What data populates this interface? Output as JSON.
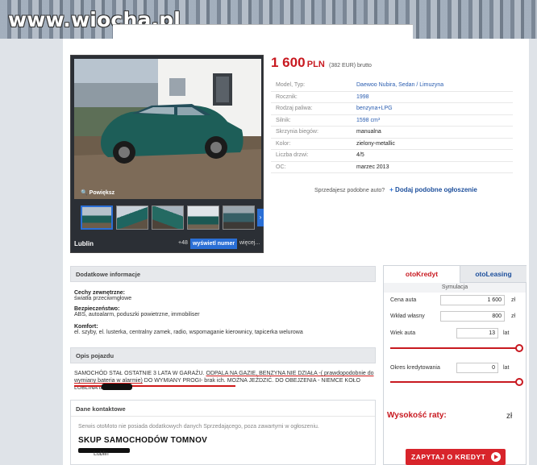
{
  "watermark": "www.wiocha.pl",
  "gallery": {
    "zoom_label": "Powiększ",
    "location": "Lublin",
    "photos_more": "+48",
    "phone_button": "wyświetl numer",
    "more_link": "więcej..."
  },
  "listing": {
    "price": "1 600",
    "currency": "PLN",
    "price_eur": "(382 EUR) brutto",
    "params": [
      {
        "label": "Model, Typ:",
        "value": "Daewoo Nubira, Sedan / Limuzyna",
        "link": true
      },
      {
        "label": "Rocznik:",
        "value": "1998",
        "link": true
      },
      {
        "label": "Rodzaj paliwa:",
        "value": "benzyna+LPG",
        "link": true
      },
      {
        "label": "Silnik:",
        "value": "1598 cm³",
        "link": true
      },
      {
        "label": "Skrzynia biegów:",
        "value": "manualna",
        "link": false
      },
      {
        "label": "Kolor:",
        "value": "zielony-metallic",
        "link": false
      },
      {
        "label": "Liczba drzwi:",
        "value": "4/5",
        "link": false
      },
      {
        "label": "OC:",
        "value": "marzec 2013",
        "link": false
      }
    ],
    "similar_question": "Sprzedajesz podobne auto?",
    "similar_add": "Dodaj podobne ogłoszenie"
  },
  "details": {
    "header": "Dodatkowe informacje",
    "groups": [
      {
        "title": "Cechy zewnętrzne:",
        "text": "światła przeciwmgłowe"
      },
      {
        "title": "Bezpieczeństwo:",
        "text": "ABS, autoalarm, poduszki powietrzne, immobiliser"
      },
      {
        "title": "Komfort:",
        "text": "el. szyby, el. lusterka, centralny zamek, radio, wspomaganie kierownicy, tapicerka welurowa"
      }
    ]
  },
  "description": {
    "header": "Opis pojazdu",
    "text_a": "SAMOCHÓD STAŁ OSTATNIE 3 LATA W GARAŻU. ",
    "text_b": "ODPALA NA GAZIE, BENZYNA NIE DZIAŁA -( prawdopodobnie do wymiany bateria w alarmie)",
    "text_c": " DO WYMIANY PROGI- brak ich. MOŻNA JEŹDZIĆ. DO OBEJZENIA - NIEMCE KOŁO LUBLINA tel. "
  },
  "contact": {
    "header": "Dane kontaktowe",
    "note": "Serwis otoMoto nie posiada dodatkowych danych Sprzedającego, poza zawartymi w ogłoszeniu.",
    "seller": "SKUP SAMOCHODÓW TOMNOV",
    "location": "Lublin"
  },
  "credit": {
    "tab_active": "otoKredyt",
    "tab_inactive": "otoLeasing",
    "section": "Symulacja",
    "rows": [
      {
        "label": "Cena auta",
        "value": "1 600",
        "unit": "zł"
      },
      {
        "label": "Wkład własny",
        "value": "800",
        "unit": "zł"
      },
      {
        "label": "Wiek auta",
        "value": "13",
        "unit": "lat"
      },
      {
        "label": "Okres kredytowania",
        "value": "0",
        "unit": "lat"
      }
    ],
    "slider_age_level": 1.0,
    "slider_period_level": 1.0,
    "rate_label": "Wysokość raty:",
    "rate_unit": "zł",
    "ask_button": "ZAPYTAJ O KREDYT"
  },
  "colors": {
    "price_red": "#c81920",
    "link_blue": "#2a5db0",
    "button_blue": "#2a6fd6"
  }
}
